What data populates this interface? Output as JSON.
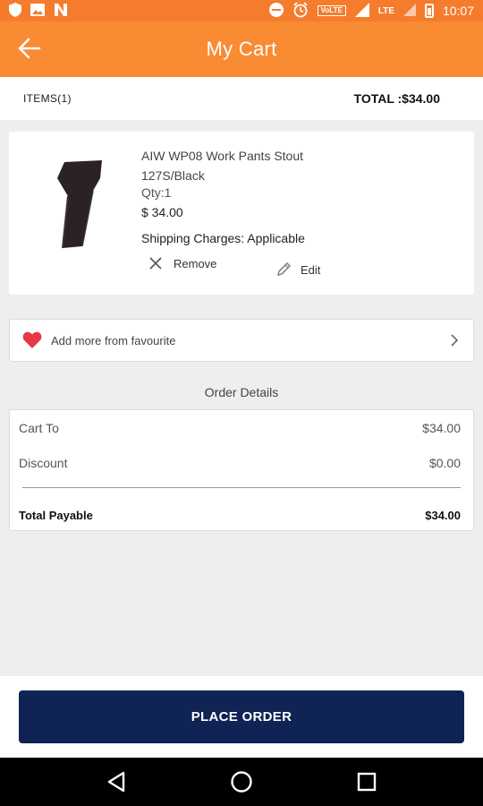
{
  "status_bar": {
    "volte": "VoLTE",
    "lte": "LTE",
    "time": "10:07",
    "icons": [
      "shield-icon",
      "image-icon",
      "n-icon",
      "dnd-icon",
      "alarm-icon",
      "signal-icon",
      "battery-icon"
    ]
  },
  "app_bar": {
    "title": "My Cart",
    "back_icon": "arrow-left-icon"
  },
  "cart_summary": {
    "items_label": "ITEMS(1)",
    "total_label": "TOTAL :$34.00"
  },
  "cart_items": [
    {
      "name": "AIW WP08 Work Pants Stout 127S/Black",
      "qty": "Qty:1",
      "price": "$ 34.00",
      "shipping": "Shipping Charges: Applicable",
      "remove_label": "Remove",
      "edit_label": "Edit"
    }
  ],
  "favourite": {
    "label": "Add more from favourite",
    "icon": "heart-icon"
  },
  "order_details": {
    "title": "Order Details",
    "rows": [
      {
        "label": "Cart To",
        "value": "$34.00"
      },
      {
        "label": "Discount",
        "value": "$0.00"
      }
    ],
    "total": {
      "label": "Total Payable",
      "value": "$34.00"
    }
  },
  "place_order_label": "PLACE ORDER",
  "colors": {
    "status_bar": "#f57c2c",
    "app_bar": "#f98b33",
    "button": "#0f2354",
    "heart": "#e53945",
    "background": "#eeeeee"
  }
}
